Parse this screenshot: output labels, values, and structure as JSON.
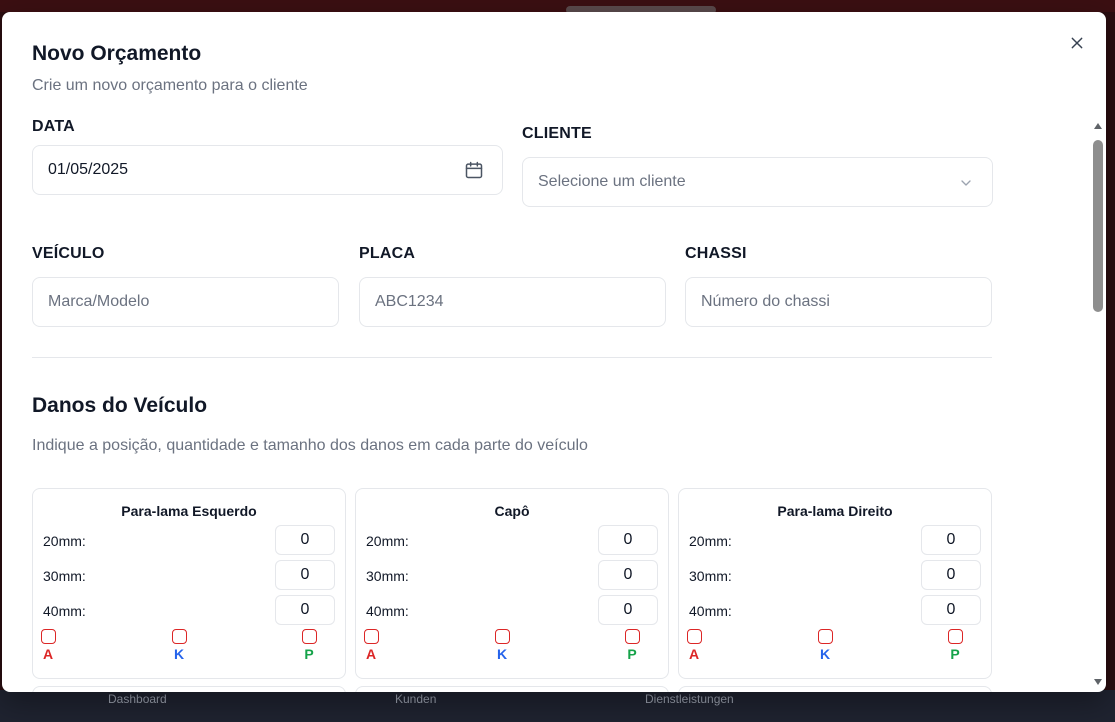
{
  "dialog": {
    "title": "Novo Orçamento",
    "subtitle": "Crie um novo orçamento para o cliente"
  },
  "form": {
    "data": {
      "label": "DATA",
      "value": "01/05/2025"
    },
    "cliente": {
      "label": "CLIENTE",
      "placeholder": "Selecione um cliente"
    },
    "veiculo": {
      "label": "VEÍCULO",
      "placeholder": "Marca/Modelo"
    },
    "placa": {
      "label": "PLACA",
      "placeholder": "ABC1234"
    },
    "chassi": {
      "label": "CHASSI",
      "placeholder": "Número do chassi"
    }
  },
  "damage": {
    "title": "Danos do Veículo",
    "description": "Indique a posição, quantidade e tamanho dos danos em cada parte do veículo",
    "sizes": [
      "20mm:",
      "30mm:",
      "40mm:"
    ],
    "options": [
      {
        "letter": "A",
        "color": "#dc2626"
      },
      {
        "letter": "K",
        "color": "#2563eb"
      },
      {
        "letter": "P",
        "color": "#16a34a"
      }
    ],
    "parts": [
      {
        "name": "Para-lama Esquerdo",
        "values": [
          "0",
          "0",
          "0"
        ]
      },
      {
        "name": "Capô",
        "values": [
          "0",
          "0",
          "0"
        ]
      },
      {
        "name": "Para-lama Direito",
        "values": [
          "0",
          "0",
          "0"
        ]
      }
    ]
  },
  "background_nav": [
    "Dashboard",
    "Kunden",
    "Dienstleistungen"
  ]
}
